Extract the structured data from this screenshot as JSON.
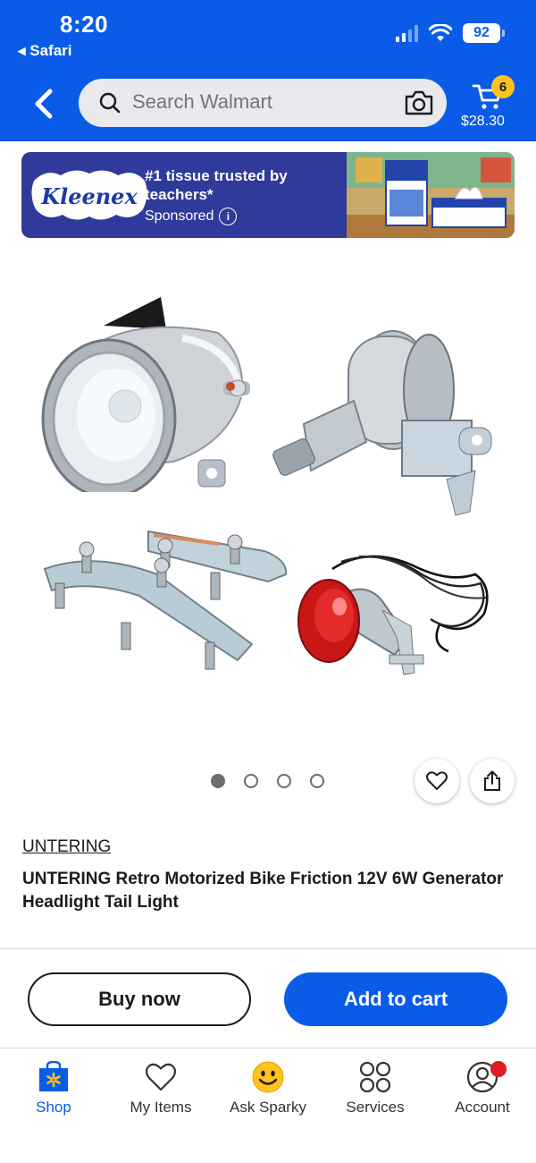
{
  "status_bar": {
    "time": "8:20",
    "back_app": "◂ Safari",
    "battery": "92"
  },
  "header": {
    "search_placeholder": "Search Walmart",
    "cart_count": "6",
    "cart_total": "$28.30"
  },
  "ad": {
    "brand_logo_text": "Kleenex",
    "headline": "#1 tissue trusted by teachers*",
    "sponsored_label": "Sponsored",
    "info_icon_glyph": "i"
  },
  "product": {
    "carousel": {
      "count": 4,
      "active_index": 0
    },
    "brand": "UNTERING",
    "title": "UNTERING Retro Motorized Bike Friction 12V 6W Generator Headlight Tail Light"
  },
  "actions": {
    "buy_now": "Buy now",
    "add_to_cart": "Add to cart"
  },
  "tabbar": {
    "items": [
      {
        "label": "Shop",
        "icon": "walmart-spark-bag-icon",
        "active": true
      },
      {
        "label": "My Items",
        "icon": "heart-icon",
        "active": false
      },
      {
        "label": "Ask Sparky",
        "icon": "smiley-icon",
        "active": false
      },
      {
        "label": "Services",
        "icon": "services-grid-icon",
        "active": false
      },
      {
        "label": "Account",
        "icon": "person-icon",
        "active": false,
        "notification": true
      }
    ]
  },
  "colors": {
    "walmart_blue": "#0a5ce8",
    "cart_badge": "#ffc220",
    "notification_red": "#de1c24"
  }
}
